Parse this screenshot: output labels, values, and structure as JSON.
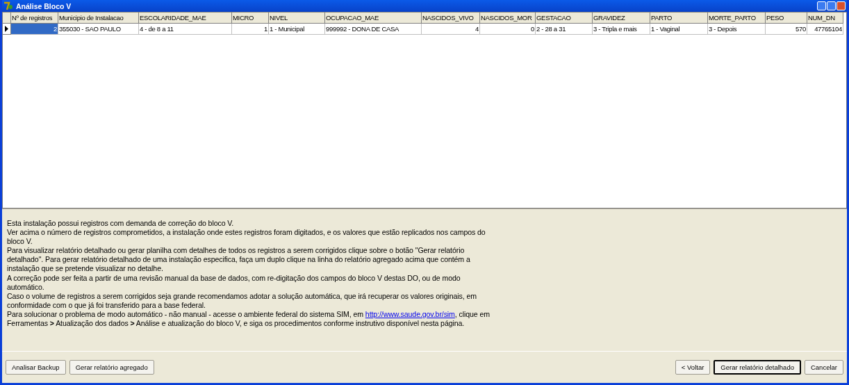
{
  "window": {
    "title": "Análise Bloco V"
  },
  "table": {
    "columns": [
      {
        "label": "Nº de registros",
        "numeric": true
      },
      {
        "label": "Municipio de Instalacao",
        "numeric": false
      },
      {
        "label": "ESCOLARIDADE_MAE",
        "numeric": false
      },
      {
        "label": "MICRO",
        "numeric": true
      },
      {
        "label": "NIVEL",
        "numeric": false
      },
      {
        "label": "OCUPACAO_MAE",
        "numeric": false
      },
      {
        "label": "NASCIDOS_VIVO",
        "numeric": true
      },
      {
        "label": "NASCIDOS_MOR",
        "numeric": true
      },
      {
        "label": "GESTACAO",
        "numeric": false
      },
      {
        "label": "GRAVIDEZ",
        "numeric": false
      },
      {
        "label": "PARTO",
        "numeric": false
      },
      {
        "label": "MORTE_PARTO",
        "numeric": false
      },
      {
        "label": "PESO",
        "numeric": true
      },
      {
        "label": "NUM_DN",
        "numeric": true
      }
    ],
    "rows": [
      {
        "current": true,
        "cells": [
          {
            "text": "2",
            "selected": true
          },
          {
            "text": "355030 - SAO PAULO",
            "selected": false
          },
          {
            "text": "4 - de 8 a 11",
            "selected": false
          },
          {
            "text": "1",
            "selected": false
          },
          {
            "text": "1 - Municipal",
            "selected": false
          },
          {
            "text": "999992 - DONA DE CASA",
            "selected": false
          },
          {
            "text": "4",
            "selected": false
          },
          {
            "text": "0",
            "selected": false
          },
          {
            "text": "2 - 28 a 31",
            "selected": false
          },
          {
            "text": "3 - Tripla e mais",
            "selected": false
          },
          {
            "text": "1 - Vaginal",
            "selected": false
          },
          {
            "text": "3 - Depois",
            "selected": false
          },
          {
            "text": "570",
            "selected": false
          },
          {
            "text": "47765104",
            "selected": false
          }
        ]
      }
    ]
  },
  "info": {
    "paragraphs": [
      "Esta instalação possui registros com demanda de correção do bloco V.",
      "Ver acima o número de registros comprometidos, a instalação onde estes registros foram digitados, e os valores que estão replicados nos campos do bloco V.",
      "Para visualizar relatório detalhado ou gerar planilha com detalhes de todos os registros a serem corrigidos clique sobre o botão \"Gerar relatório detalhado\". Para gerar relatório detalhado de uma instalação especifica, faça um duplo clique na linha do relatório agregado acima que contém a instalação que se pretende visualizar no detalhe.",
      "A correção pode ser feita a partir de uma revisão manual da base de dados, com re-digitação dos campos do bloco V destas DO, ou de modo automático.",
      "Caso o volume de registros a serem corrigidos seja grande recomendamos adotar a solução automática, que irá recuperar os valores originais, em conformidade com o que já foi transferido para a base federal."
    ],
    "last": {
      "before": "Para solucionar o problema de modo automático - não manual - acesse o ambiente federal do sistema SIM, em",
      "link": "http://www.saude.gov.br/sim",
      "after": ", clique em Ferramentas **>** Atualização dos dados **>** Análise e atualização do bloco V, e siga os procedimentos conforme instrutivo disponível nesta página."
    }
  },
  "buttons_left": [
    {
      "label": "Analisar Backup",
      "default": false
    },
    {
      "label": "Gerar relatório agregado",
      "default": false
    }
  ],
  "buttons_right": [
    {
      "label": "< Voltar",
      "default": false
    },
    {
      "label": "Gerar relatório detalhado",
      "default": true
    },
    {
      "label": "Cancelar",
      "default": false
    }
  ]
}
